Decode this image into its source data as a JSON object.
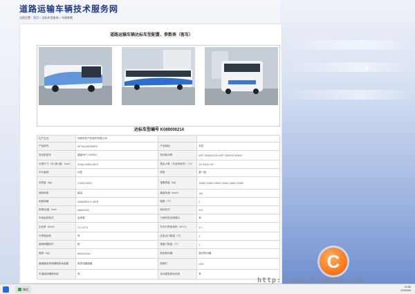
{
  "site": {
    "title": "道路运输车辆技术服务网",
    "breadcrumb_prefix": "当前位置：",
    "breadcrumb_home": "首页",
    "breadcrumb_rest": " > 达标车型查询 > 车辆参数"
  },
  "panel": {
    "title": "道路运输车辆达标车型配置、参数表（客车）",
    "cert_label": "达标车型编号",
    "cert_number": "K089000214"
  },
  "specs": [
    [
      "生产企业",
      "安徽安凯汽车股份有限公司",
      "",
      ""
    ],
    [
      "产品型号",
      "HFF6120KDE5FB",
      "产品商标",
      "安凯"
    ],
    [
      "发动机型号",
      "潍柴WP7.300E51",
      "发动机功率",
      "WP7.300E51/220,WP7.300E51/240kW"
    ],
    [
      "外廓尺寸（长×宽×高）（mm）",
      "11990×2550×3670",
      "乘坐人数（不含驾驶员）（人）",
      "24~51/24~50"
    ],
    [
      "车长级别",
      "大型",
      "类型",
      "高一级"
    ],
    [
      "总质量（kg）",
      "17000,18000",
      "整备质量（kg）",
      "12500,12600,13000,13400,13600,12500"
    ],
    [
      "燃料种类",
      "柴油",
      "最高车速（km/h）",
      "100"
    ],
    [
      "轮胎规格",
      "295/80R22.5 16PR",
      "轴数（个）",
      "2"
    ],
    [
      "前悬/后悬（mm）",
      "2650/3340",
      "驱动形式",
      "4×2"
    ],
    [
      "车身结构型式",
      "全承载",
      "行驶时安全带提示",
      "有"
    ],
    [
      "比功率（kW/t）",
      "13.4,12.9",
      "车内行李架体积（m³/人）",
      "0.1"
    ],
    [
      "行李舱容积",
      "有",
      "应急出口数量（个）",
      "2"
    ],
    [
      "座椅侧翻防护",
      "有",
      "乘客门数量（个）",
      "1"
    ],
    [
      "轴荷（kg）",
      "6500/11500",
      "前轮制动器",
      "盘式制动器"
    ],
    [
      "缓速器或其他辅助制动装置",
      "电涡流缓速器",
      "前照灯",
      "LED"
    ],
    [
      "车道保持辅助系统",
      "有",
      "自动紧急制动系统",
      "有"
    ]
  ],
  "taskbar": {
    "app_label": "微信",
    "time": "10:55",
    "date": "2024/5/8"
  },
  "watermark": {
    "logo_letter": "C",
    "text": "http://www.51chuli.com"
  }
}
